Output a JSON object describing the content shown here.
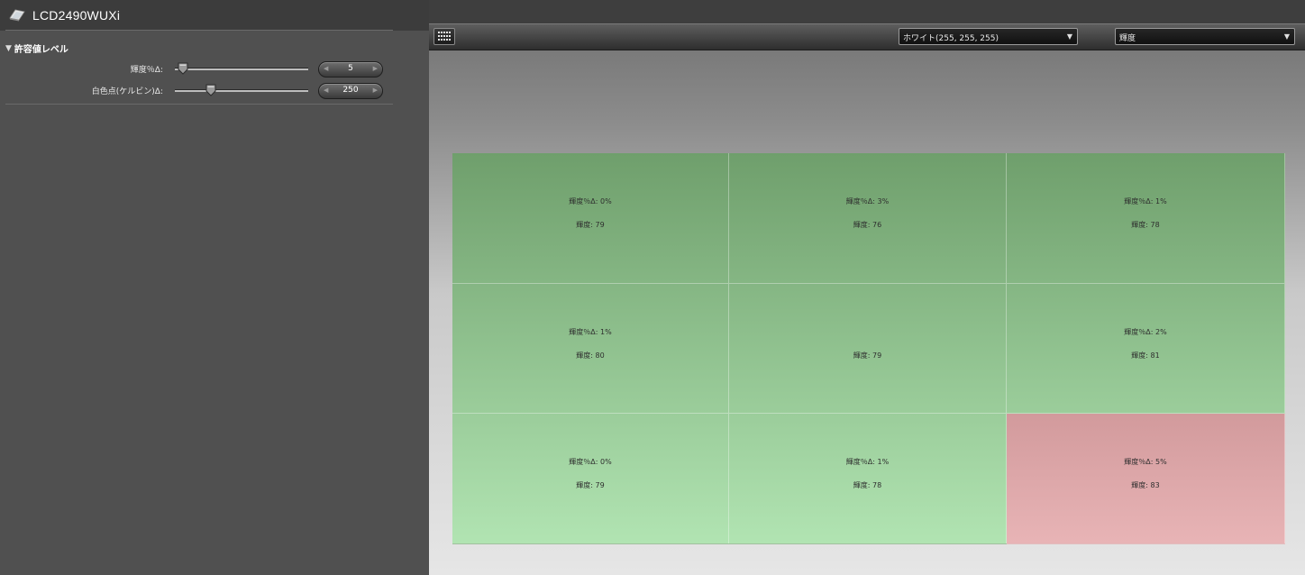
{
  "app": {
    "title": "LCD2490WUXi"
  },
  "tolerance": {
    "header": "許容値レベル",
    "rows": [
      {
        "label": "輝度％Δ:",
        "value": "5",
        "level": 0.06
      },
      {
        "label": "白色点(ケルビン)Δ:",
        "value": "250",
        "level": 0.27
      }
    ]
  },
  "toolbar": {
    "color_select": "ホワイト(255, 255, 255)",
    "metric_select": "輝度"
  },
  "colors": {
    "cell_ok_top": "#6f9f6c",
    "cell_ok_bottom": "#b1e4b2",
    "cell_fail_top": "#d29a9c",
    "cell_fail_bottom": "#e8b4b6"
  },
  "grid": {
    "cells": [
      {
        "line1": "輝度％Δ: 0%",
        "line2": "輝度: 79",
        "status": "ok"
      },
      {
        "line1": "輝度％Δ: 3%",
        "line2": "輝度: 76",
        "status": "ok"
      },
      {
        "line1": "輝度％Δ: 1%",
        "line2": "輝度: 78",
        "status": "ok"
      },
      {
        "line1": "輝度％Δ: 1%",
        "line2": "輝度: 80",
        "status": "ok"
      },
      {
        "line1": "",
        "line2": "輝度: 79",
        "status": "ok"
      },
      {
        "line1": "輝度％Δ: 2%",
        "line2": "輝度: 81",
        "status": "ok"
      },
      {
        "line1": "輝度％Δ: 0%",
        "line2": "輝度: 79",
        "status": "ok"
      },
      {
        "line1": "輝度％Δ: 1%",
        "line2": "輝度: 78",
        "status": "ok"
      },
      {
        "line1": "輝度％Δ: 5%",
        "line2": "輝度: 83",
        "status": "fail"
      }
    ]
  }
}
